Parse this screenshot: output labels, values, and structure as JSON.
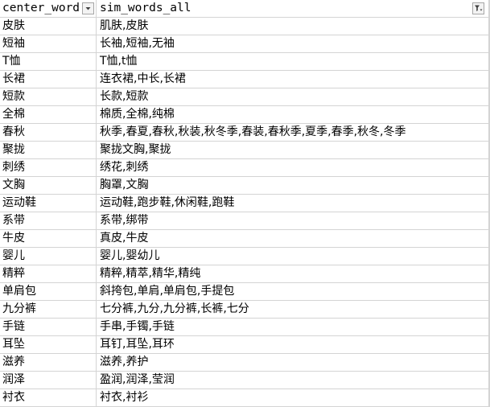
{
  "columns": [
    {
      "label": "center_word",
      "filter": "dropdown-icon"
    },
    {
      "label": "sim_words_all",
      "filter": "filter-applied-icon"
    }
  ],
  "rows": [
    [
      "皮肤",
      "肌肤,皮肤"
    ],
    [
      "短袖",
      "长袖,短袖,无袖"
    ],
    [
      "T恤",
      "T恤,t恤"
    ],
    [
      "长裙",
      "连衣裙,中长,长裙"
    ],
    [
      "短款",
      "长款,短款"
    ],
    [
      "全棉",
      "棉质,全棉,纯棉"
    ],
    [
      "春秋",
      "秋季,春夏,春秋,秋装,秋冬季,春装,春秋季,夏季,春季,秋冬,冬季"
    ],
    [
      "聚拢",
      "聚拢文胸,聚拢"
    ],
    [
      "刺绣",
      "绣花,刺绣"
    ],
    [
      "文胸",
      "胸罩,文胸"
    ],
    [
      "运动鞋",
      "运动鞋,跑步鞋,休闲鞋,跑鞋"
    ],
    [
      "系带",
      "系带,绑带"
    ],
    [
      "牛皮",
      "真皮,牛皮"
    ],
    [
      "婴儿",
      "婴儿,婴幼儿"
    ],
    [
      "精粹",
      "精粹,精萃,精华,精纯"
    ],
    [
      "单肩包",
      "斜挎包,单肩,单肩包,手提包"
    ],
    [
      "九分裤",
      "七分裤,九分,九分裤,长裤,七分"
    ],
    [
      "手链",
      "手串,手镯,手链"
    ],
    [
      "耳坠",
      "耳钉,耳坠,耳环"
    ],
    [
      "滋养",
      "滋养,养护"
    ],
    [
      "润泽",
      "盈润,润泽,莹润"
    ],
    [
      "衬衣",
      "衬衣,衬衫"
    ]
  ]
}
